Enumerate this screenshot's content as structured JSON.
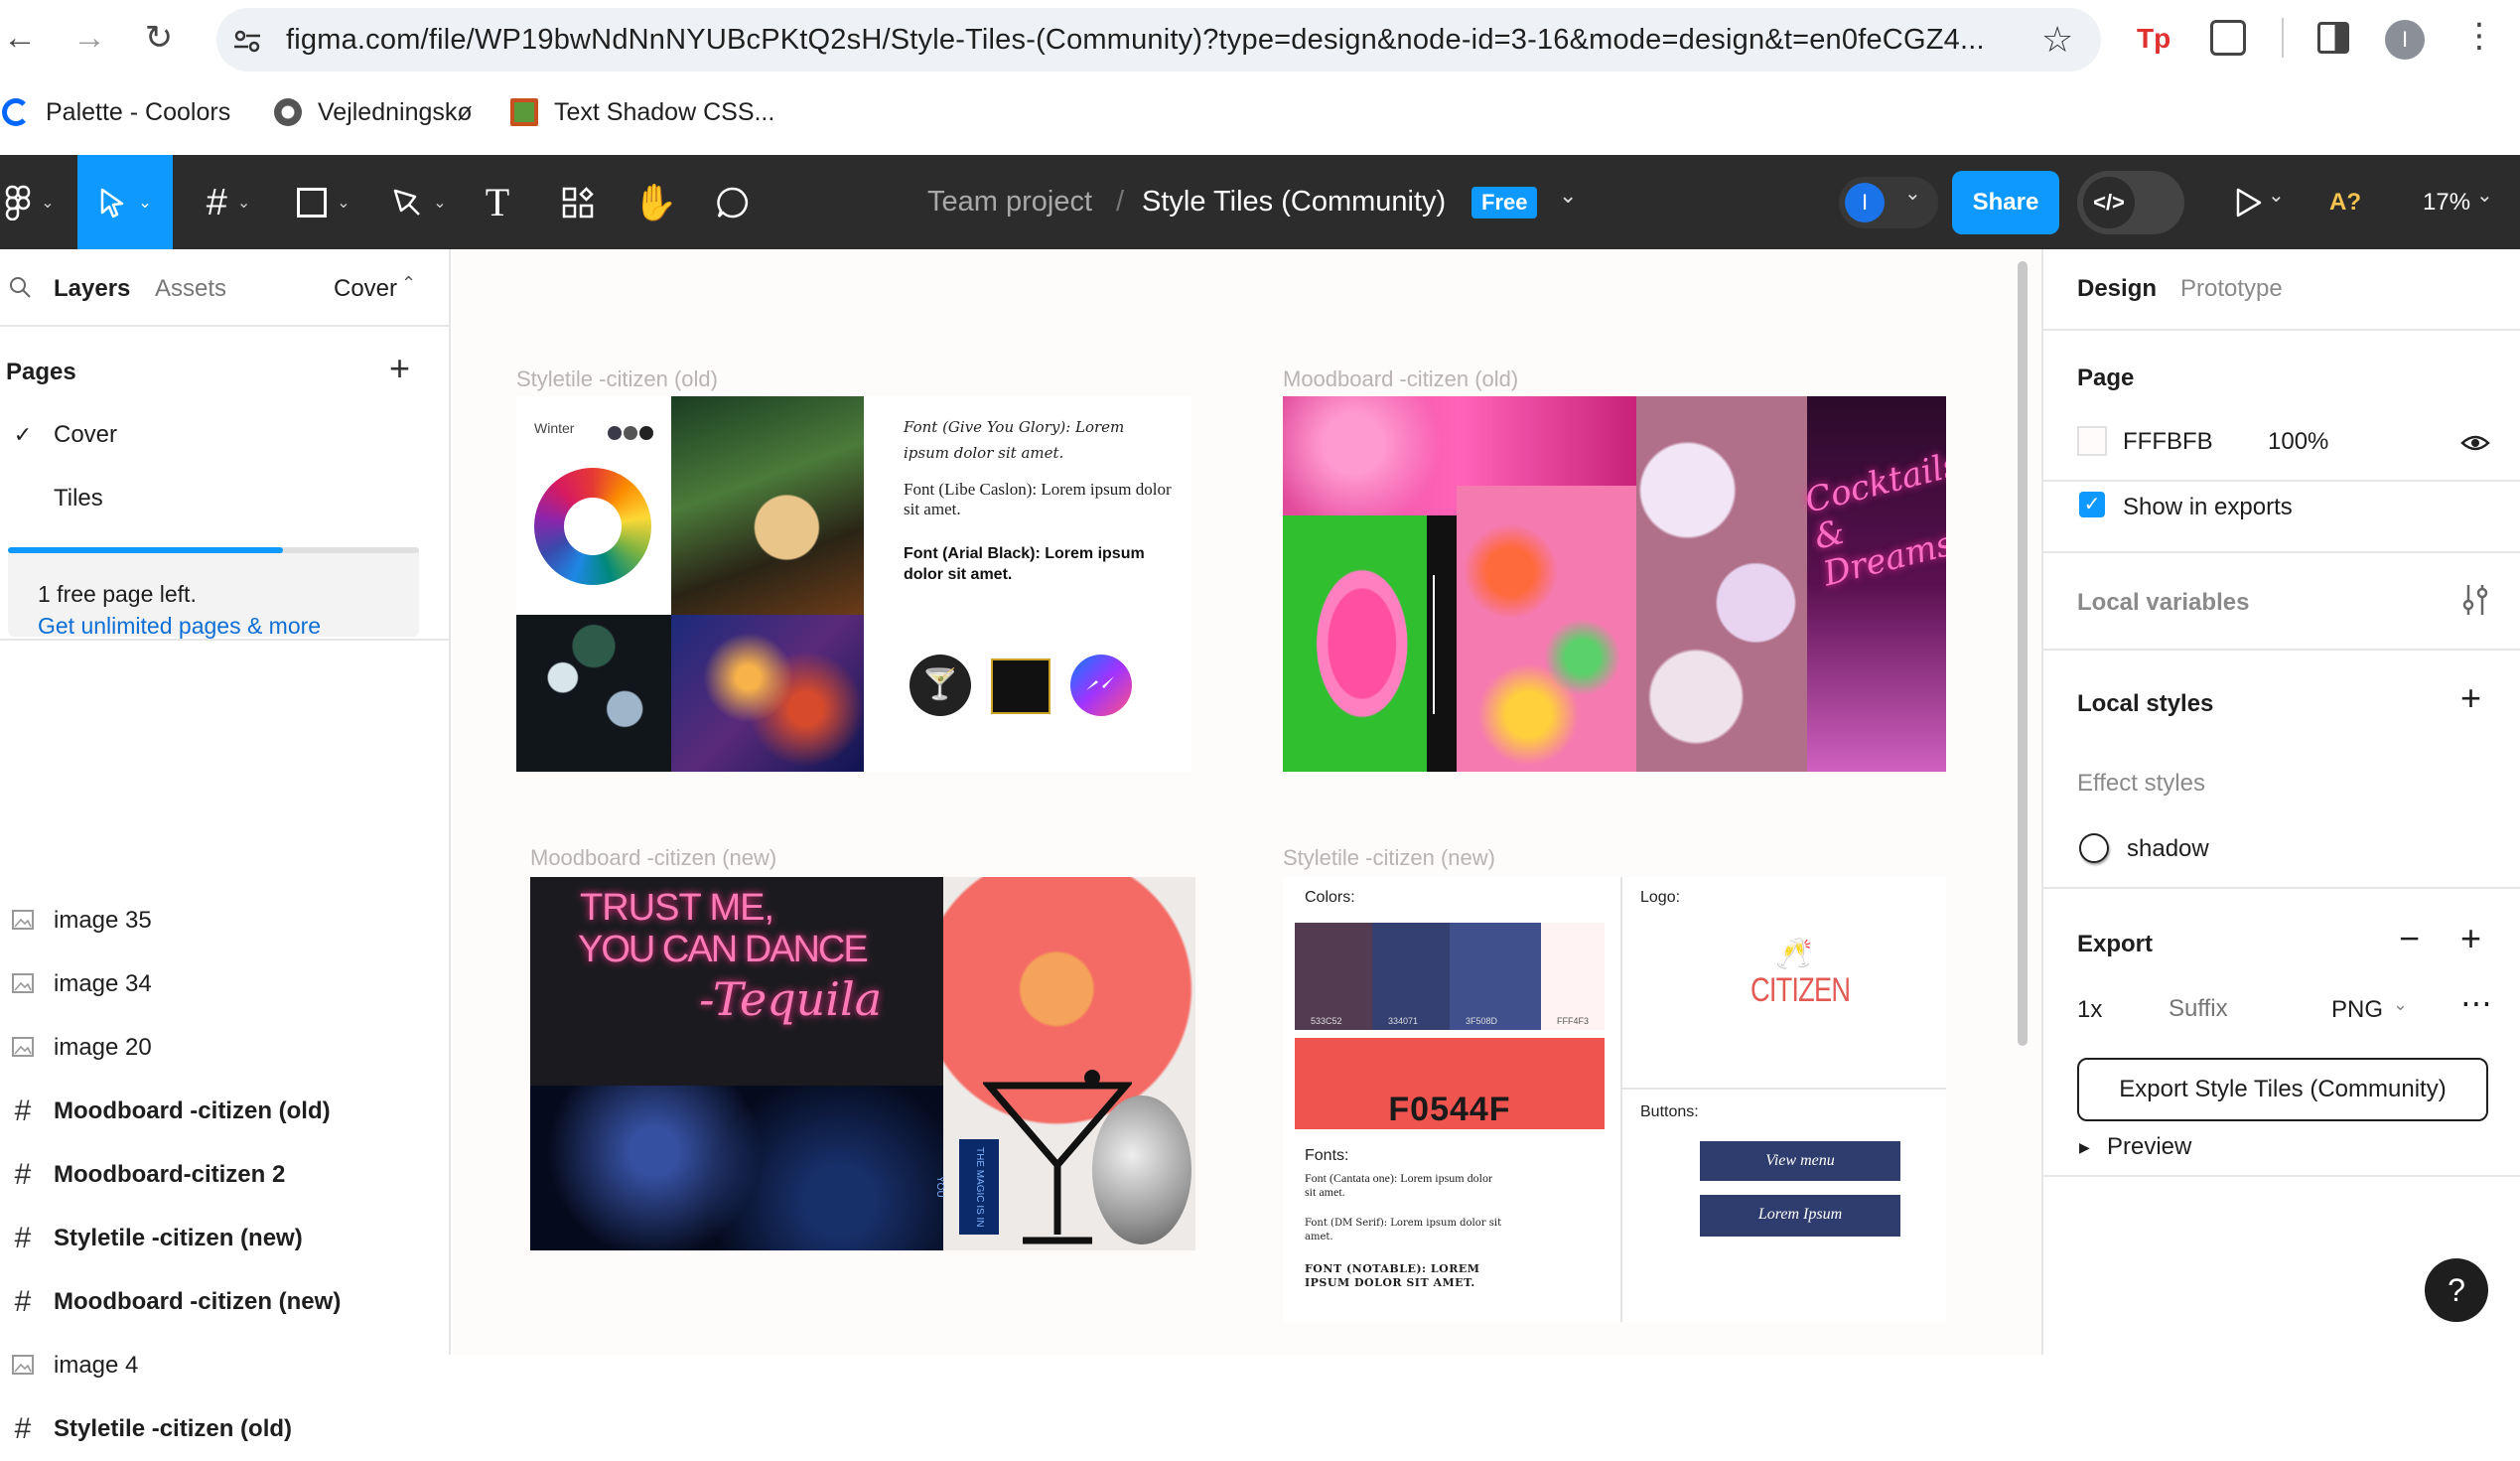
{
  "browser": {
    "url": "figma.com/file/WP19bwNdNnNYUBcPKtQ2sH/Style-Tiles-(Community)?type=design&node-id=3-16&mode=design&t=en0feCGZ4...",
    "bookmarks": [
      "Palette - Coolors",
      "Vejledningskø",
      "Text Shadow CSS..."
    ],
    "profile_initial": "I"
  },
  "toolbar": {
    "breadcrumb_project": "Team project",
    "breadcrumb_sep": "/",
    "file_title": "Style Tiles (Community)",
    "plan_badge": "Free",
    "avatar_initial": "I",
    "share_label": "Share",
    "dev_mode_label": "</>",
    "a11y_label": "A?",
    "zoom_label": "17%"
  },
  "left_panel": {
    "tabs": [
      "Layers",
      "Assets"
    ],
    "page_selector": "Cover",
    "pages_heading": "Pages",
    "pages": [
      {
        "label": "Cover",
        "checked": true
      },
      {
        "label": "Tiles",
        "checked": false
      }
    ],
    "upsell_text": "1 free page left.",
    "upsell_link": "Get unlimited pages & more",
    "usage_fraction": 0.67,
    "layers": [
      {
        "label": "image 35",
        "type": "image"
      },
      {
        "label": "image 34",
        "type": "image"
      },
      {
        "label": "image 20",
        "type": "image"
      },
      {
        "label": "Moodboard -citizen (old)",
        "type": "frame"
      },
      {
        "label": "Moodboard-citizen 2",
        "type": "frame"
      },
      {
        "label": "Styletile -citizen (new)",
        "type": "frame"
      },
      {
        "label": "Moodboard -citizen (new)",
        "type": "frame"
      },
      {
        "label": "image 4",
        "type": "image"
      },
      {
        "label": "Styletile -citizen (old)",
        "type": "frame"
      }
    ]
  },
  "canvas": {
    "frames": {
      "styletile_old": {
        "label": "Styletile -citizen (old)",
        "winter": "Winter",
        "font1": "Font (Give You Glory): Lorem ipsum dolor sit amet.",
        "font2": "Font (Libe Caslon): Lorem ipsum dolor sit amet.",
        "font3": "Font (Arial Black): Lorem ipsum dolor sit amet."
      },
      "moodboard_old": {
        "label": "Moodboard -citizen (old)",
        "neon": "Cocktails & Dreams"
      },
      "moodboard_new": {
        "label": "Moodboard -citizen (new)",
        "neon_line1": "TRUST ME,",
        "neon_line2": "YOU CAN DANCE",
        "neon_line3": "-Tequila",
        "poster": "THE MAGIC IS IN YOU"
      },
      "styletile_new": {
        "label": "Styletile -citizen (new)",
        "colors_heading": "Colors:",
        "swatches": [
          {
            "hex": "533C52",
            "color": "#533C52"
          },
          {
            "hex": "334071",
            "color": "#334071"
          },
          {
            "hex": "3F508D",
            "color": "#3F508D"
          },
          {
            "hex": "FFF4F3",
            "color": "#FFF4F3"
          }
        ],
        "accent_hex": "F0544F",
        "accent_color": "#F0544F",
        "logo_heading": "Logo:",
        "logo_text": "CITIZEN",
        "fonts_heading": "Fonts:",
        "font1": "Font (Cantata one): Lorem ipsum dolor sit amet.",
        "font2": "Font (DM Serif): Lorem ipsum dolor sit amet.",
        "font3": "FONT (NOTABLE): LOREM IPSUM DOLOR SIT AMET.",
        "buttons_heading": "Buttons:",
        "button1": "View menu",
        "button2": "Lorem Ipsum"
      }
    }
  },
  "right_panel": {
    "tabs": [
      "Design",
      "Prototype"
    ],
    "page_heading": "Page",
    "bg_hex": "FFFBFB",
    "bg_opacity": "100%",
    "show_in_exports": "Show in exports",
    "local_variables": "Local variables",
    "local_styles": "Local styles",
    "effect_styles": "Effect styles",
    "effect_style_name": "shadow",
    "export_heading": "Export",
    "export_scale": "1x",
    "export_suffix_placeholder": "Suffix",
    "export_format": "PNG",
    "export_button": "Export Style Tiles (Community)",
    "preview_label": "Preview",
    "help_label": "?"
  }
}
